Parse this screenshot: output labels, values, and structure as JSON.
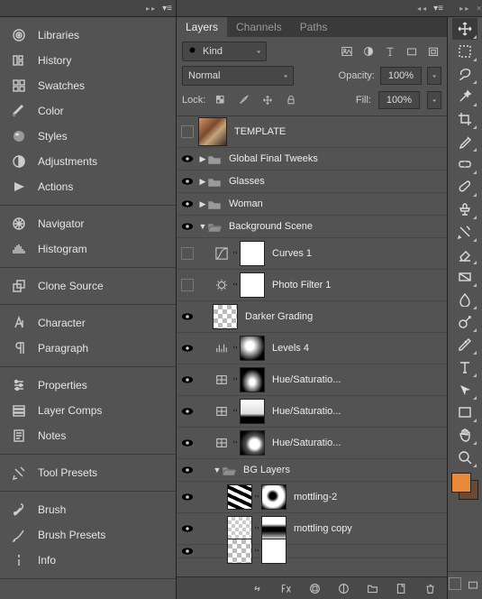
{
  "sidebar": {
    "groups": [
      {
        "items": [
          {
            "id": "libraries",
            "label": "Libraries",
            "icon": "libraries-icon"
          },
          {
            "id": "history",
            "label": "History",
            "icon": "history-icon"
          },
          {
            "id": "swatches",
            "label": "Swatches",
            "icon": "swatches-icon"
          },
          {
            "id": "color",
            "label": "Color",
            "icon": "color-icon"
          },
          {
            "id": "styles",
            "label": "Styles",
            "icon": "styles-icon"
          },
          {
            "id": "adjustments",
            "label": "Adjustments",
            "icon": "adjustments-icon"
          },
          {
            "id": "actions",
            "label": "Actions",
            "icon": "actions-icon"
          }
        ]
      },
      {
        "items": [
          {
            "id": "navigator",
            "label": "Navigator",
            "icon": "navigator-icon"
          },
          {
            "id": "histogram",
            "label": "Histogram",
            "icon": "histogram-icon"
          }
        ]
      },
      {
        "items": [
          {
            "id": "clone-source",
            "label": "Clone Source",
            "icon": "clone-source-icon"
          }
        ]
      },
      {
        "items": [
          {
            "id": "character",
            "label": "Character",
            "icon": "character-icon"
          },
          {
            "id": "paragraph",
            "label": "Paragraph",
            "icon": "paragraph-icon"
          }
        ]
      },
      {
        "items": [
          {
            "id": "properties",
            "label": "Properties",
            "icon": "properties-icon"
          },
          {
            "id": "layer-comps",
            "label": "Layer Comps",
            "icon": "layer-comps-icon"
          },
          {
            "id": "notes",
            "label": "Notes",
            "icon": "notes-icon"
          }
        ]
      },
      {
        "items": [
          {
            "id": "tool-presets",
            "label": "Tool Presets",
            "icon": "tool-presets-icon"
          }
        ]
      },
      {
        "items": [
          {
            "id": "brush",
            "label": "Brush",
            "icon": "brush-icon"
          },
          {
            "id": "brush-presets",
            "label": "Brush Presets",
            "icon": "brush-presets-icon"
          },
          {
            "id": "info",
            "label": "Info",
            "icon": "info-icon"
          }
        ]
      }
    ]
  },
  "layers_panel": {
    "tabs": [
      "Layers",
      "Channels",
      "Paths"
    ],
    "active_tab": 0,
    "filter": {
      "kind_label": "Kind"
    },
    "blend_mode": "Normal",
    "opacity_label": "Opacity:",
    "opacity_value": "100%",
    "fill_label": "Fill:",
    "fill_value": "100%",
    "lock_label": "Lock:",
    "layers": [
      {
        "type": "layer",
        "name": "TEMPLATE",
        "visible": false,
        "depth": 0,
        "thumb": "template",
        "big": true
      },
      {
        "type": "group",
        "name": "Global Final Tweeks",
        "visible": true,
        "depth": 0,
        "open": false
      },
      {
        "type": "group",
        "name": "Glasses",
        "visible": true,
        "depth": 0,
        "open": false
      },
      {
        "type": "group",
        "name": "Woman",
        "visible": true,
        "depth": 0,
        "open": false
      },
      {
        "type": "group",
        "name": "Background Scene",
        "visible": true,
        "depth": 0,
        "open": true
      },
      {
        "type": "adj",
        "name": "Curves 1",
        "visible": false,
        "depth": 1,
        "adj": "curves",
        "mask": "white"
      },
      {
        "type": "adj",
        "name": "Photo Filter 1",
        "visible": false,
        "depth": 1,
        "adj": "photo-filter",
        "mask": "white"
      },
      {
        "type": "layer",
        "name": "Darker Grading",
        "visible": true,
        "depth": 1,
        "thumb": "checker"
      },
      {
        "type": "adj",
        "name": "Levels 4",
        "visible": true,
        "depth": 1,
        "adj": "levels",
        "mask": "levels"
      },
      {
        "type": "adj",
        "name": "Hue/Saturatio...",
        "visible": true,
        "depth": 1,
        "adj": "hue",
        "mask": "hue1"
      },
      {
        "type": "adj",
        "name": "Hue/Saturatio...",
        "visible": true,
        "depth": 1,
        "adj": "hue",
        "mask": "hue2"
      },
      {
        "type": "adj",
        "name": "Hue/Saturatio...",
        "visible": true,
        "depth": 1,
        "adj": "hue",
        "mask": "hue3"
      },
      {
        "type": "group",
        "name": "BG Layers",
        "visible": true,
        "depth": 1,
        "open": true
      },
      {
        "type": "masked",
        "name": "mottling-2",
        "visible": true,
        "depth": 2,
        "thumb": "zebra",
        "mask": "mot1"
      },
      {
        "type": "masked",
        "name": "mottling copy",
        "visible": true,
        "depth": 2,
        "thumb": "mot2",
        "mask": "mot2"
      },
      {
        "type": "masked",
        "name": "",
        "visible": true,
        "depth": 2,
        "thumb": "checker",
        "mask": "white",
        "cut": true
      }
    ]
  },
  "toolbar": {
    "tools": [
      {
        "id": "move",
        "icon": "move-icon",
        "sel": true
      },
      {
        "id": "marquee",
        "icon": "marquee-icon"
      },
      {
        "id": "lasso",
        "icon": "lasso-icon"
      },
      {
        "id": "magic-wand",
        "icon": "magic-wand-icon"
      },
      {
        "id": "crop",
        "icon": "crop-icon"
      },
      {
        "id": "eyedropper",
        "icon": "eyedropper-icon"
      },
      {
        "id": "healing",
        "icon": "healing-icon"
      },
      {
        "id": "brush",
        "icon": "tool-brush-icon"
      },
      {
        "id": "clone-stamp",
        "icon": "clone-stamp-icon"
      },
      {
        "id": "history-brush",
        "icon": "history-brush-icon"
      },
      {
        "id": "eraser",
        "icon": "eraser-icon"
      },
      {
        "id": "gradient",
        "icon": "gradient-icon"
      },
      {
        "id": "blur",
        "icon": "blur-icon"
      },
      {
        "id": "dodge",
        "icon": "dodge-icon"
      },
      {
        "id": "pen",
        "icon": "pen-icon"
      },
      {
        "id": "type",
        "icon": "type-icon"
      },
      {
        "id": "path-select",
        "icon": "path-select-icon"
      },
      {
        "id": "shape",
        "icon": "shape-icon"
      },
      {
        "id": "hand",
        "icon": "hand-icon"
      },
      {
        "id": "zoom",
        "icon": "zoom-icon"
      }
    ]
  }
}
